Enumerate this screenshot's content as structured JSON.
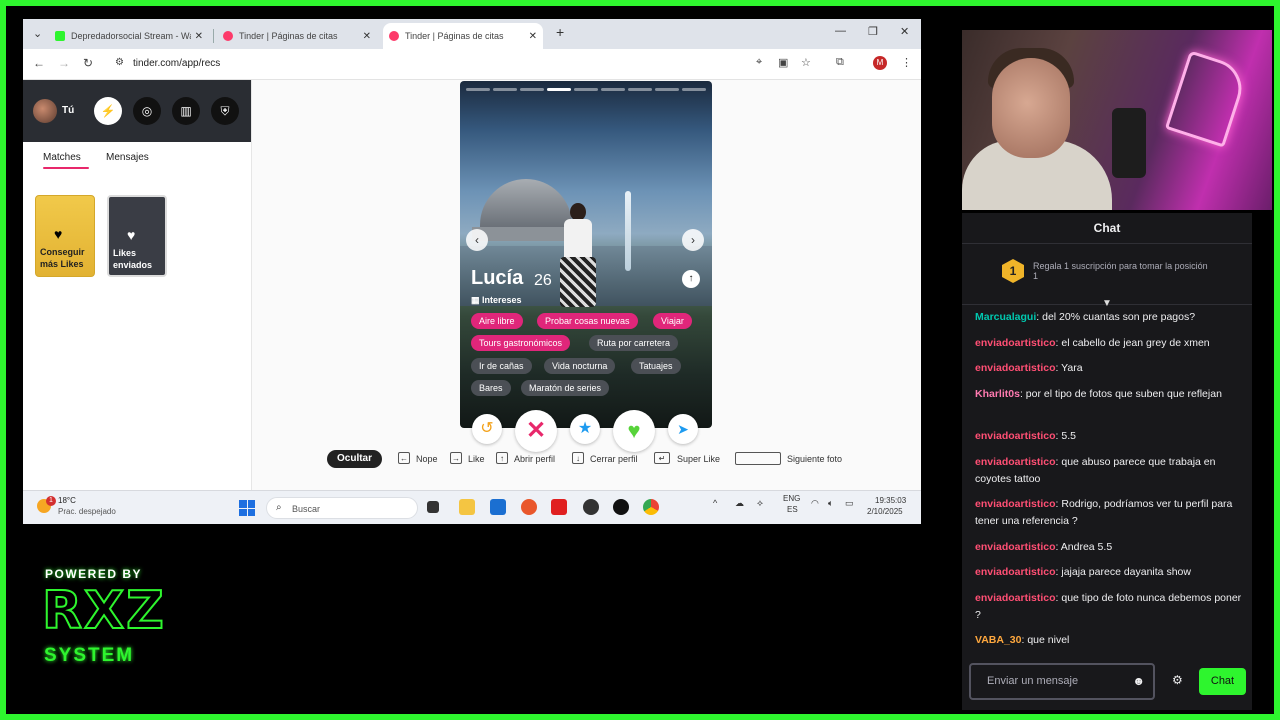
{
  "browser": {
    "tabs": [
      {
        "title": "Depredadorsocial Stream - Wa",
        "active": false,
        "icon": "kick-icon"
      },
      {
        "title": "Tinder | Páginas de citas",
        "active": false,
        "icon": "tinder-flame-icon"
      },
      {
        "title": "Tinder | Páginas de citas",
        "active": true,
        "icon": "tinder-flame-icon"
      }
    ],
    "new_tab": "+",
    "url": "tinder.com/app/recs",
    "profile_initial": "M"
  },
  "tinder": {
    "me_label": "Tú",
    "tabs": [
      "Matches",
      "Mensajes"
    ],
    "cards": [
      "Conseguir más Likes",
      "Likes enviados"
    ],
    "profile": {
      "name": "Lucía",
      "age": "26",
      "interests_label": "Intereses",
      "chips": [
        {
          "label": "Aire libre",
          "highlight": true
        },
        {
          "label": "Probar cosas nuevas",
          "highlight": true
        },
        {
          "label": "Viajar",
          "highlight": true
        },
        {
          "label": "Tours gastronómicos",
          "highlight": true
        },
        {
          "label": "Ruta por carretera",
          "highlight": false
        },
        {
          "label": "Ir de cañas",
          "highlight": false
        },
        {
          "label": "Vida nocturna",
          "highlight": false
        },
        {
          "label": "Tatuajes",
          "highlight": false
        },
        {
          "label": "Bares",
          "highlight": false
        },
        {
          "label": "Maratón de series",
          "highlight": false
        }
      ],
      "photo_count": 9,
      "current_photo": 4
    },
    "hints": {
      "hide": "Ocultar",
      "nope": "Nope",
      "like": "Like",
      "open": "Abrir perfil",
      "close": "Cerrar perfil",
      "superlike": "Super Like",
      "next_photo": "Siguiente foto"
    }
  },
  "taskbar": {
    "temp": "18°C",
    "weather": "Prac. despejado",
    "weather_badge": "1",
    "search": "Buscar",
    "lang1": "ENG",
    "lang2": "ES",
    "time": "19:35:03",
    "date": "2/10/2025"
  },
  "chat": {
    "title": "Chat",
    "gift_rank": "1",
    "gift_text": "Regala 1 suscripción para tomar la posición 1",
    "messages": [
      {
        "user": "Marcualagui",
        "text": ": del 20% cuantas son pre pagos?",
        "color": "#00c8af"
      },
      {
        "user": "enviadoartistico",
        "text": ": el cabello de jean grey de xmen",
        "color": "#ff4f74"
      },
      {
        "user": "enviadoartistico",
        "text": ": Yara",
        "color": "#ff4f74"
      },
      {
        "user": "Kharlit0s",
        "text": ": por el tipo de fotos que suben que reflejan",
        "color": "#ff7ab0"
      },
      {
        "user": "enviadoartistico",
        "text": ": 5.5",
        "color": "#ff4f74"
      },
      {
        "user": "enviadoartistico",
        "text": ": que abuso parece que trabaja en coyotes tattoo",
        "color": "#ff4f74"
      },
      {
        "user": "enviadoartistico",
        "text": ": Rodrigo, podríamos ver tu perfil para tener una referencia ?",
        "color": "#ff4f74"
      },
      {
        "user": "enviadoartistico",
        "text": ": Andrea 5.5",
        "color": "#ff4f74"
      },
      {
        "user": "enviadoartistico",
        "text": ": jajaja parece dayanita show",
        "color": "#ff4f74"
      },
      {
        "user": "enviadoartistico",
        "text": ": que tipo de foto nunca debemos poner ?",
        "color": "#ff4f74"
      },
      {
        "user": "VABA_30",
        "text": ": que nivel",
        "color": "#ffa83e"
      }
    ],
    "input_placeholder": "Enviar un mensaje",
    "send_label": "Chat"
  },
  "logo": {
    "top": "POWERED BY",
    "middle": "RXZ",
    "bottom": "SYSTEM"
  },
  "colors": {
    "frame": "#2ef52e",
    "tinder_pink": "#e0267a",
    "chat_bg": "#18181b"
  }
}
